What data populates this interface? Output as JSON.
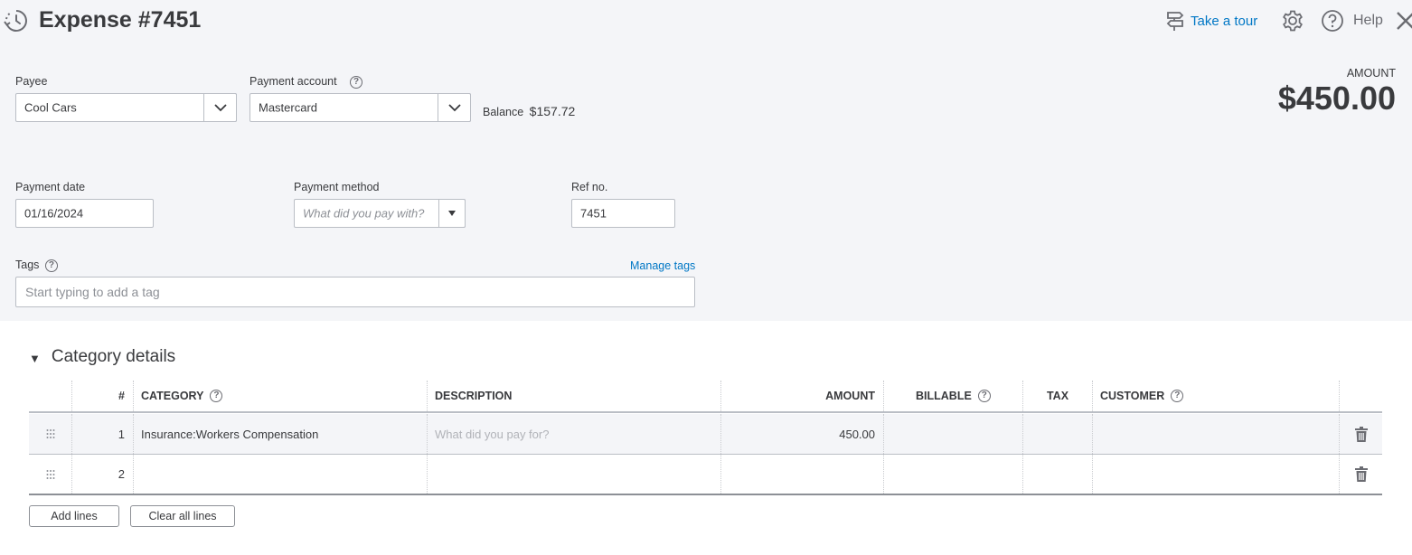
{
  "header": {
    "title": "Expense #7451",
    "take_tour": "Take a tour",
    "help": "Help"
  },
  "form": {
    "payee": {
      "label": "Payee",
      "value": "Cool Cars"
    },
    "payment_account": {
      "label": "Payment account",
      "value": "Mastercard",
      "help": "?"
    },
    "balance": {
      "label": "Balance",
      "value": "$157.72"
    },
    "amount": {
      "label": "AMOUNT",
      "value": "$450.00"
    },
    "payment_date": {
      "label": "Payment date",
      "value": "01/16/2024"
    },
    "payment_method": {
      "label": "Payment method",
      "placeholder": "What did you pay with?"
    },
    "ref_no": {
      "label": "Ref no.",
      "value": "7451"
    },
    "tags": {
      "label": "Tags",
      "placeholder": "Start typing to add a tag",
      "manage": "Manage tags",
      "help": "?"
    }
  },
  "category_details": {
    "title": "Category details",
    "toggle": "▼",
    "columns": {
      "num": "#",
      "category": "CATEGORY",
      "description": "DESCRIPTION",
      "amount": "AMOUNT",
      "billable": "BILLABLE",
      "tax": "TAX",
      "customer": "CUSTOMER",
      "help": "?"
    },
    "rows": [
      {
        "num": "1",
        "category": "Insurance:Workers Compensation",
        "description_placeholder": "What did you pay for?",
        "amount": "450.00"
      },
      {
        "num": "2",
        "category": "",
        "description_placeholder": "",
        "amount": ""
      }
    ],
    "add_lines": "Add lines",
    "clear_lines": "Clear all lines"
  },
  "colors": {
    "link": "#0077c5",
    "text": "#393a3d",
    "panel": "#f4f5f8",
    "border": "#babec5"
  },
  "icons": [
    "history-icon",
    "signpost-icon",
    "gear-icon",
    "help-circle-icon",
    "close-icon",
    "chevron-down-icon",
    "caret-down-icon",
    "drag-handle-icon",
    "trash-icon"
  ]
}
